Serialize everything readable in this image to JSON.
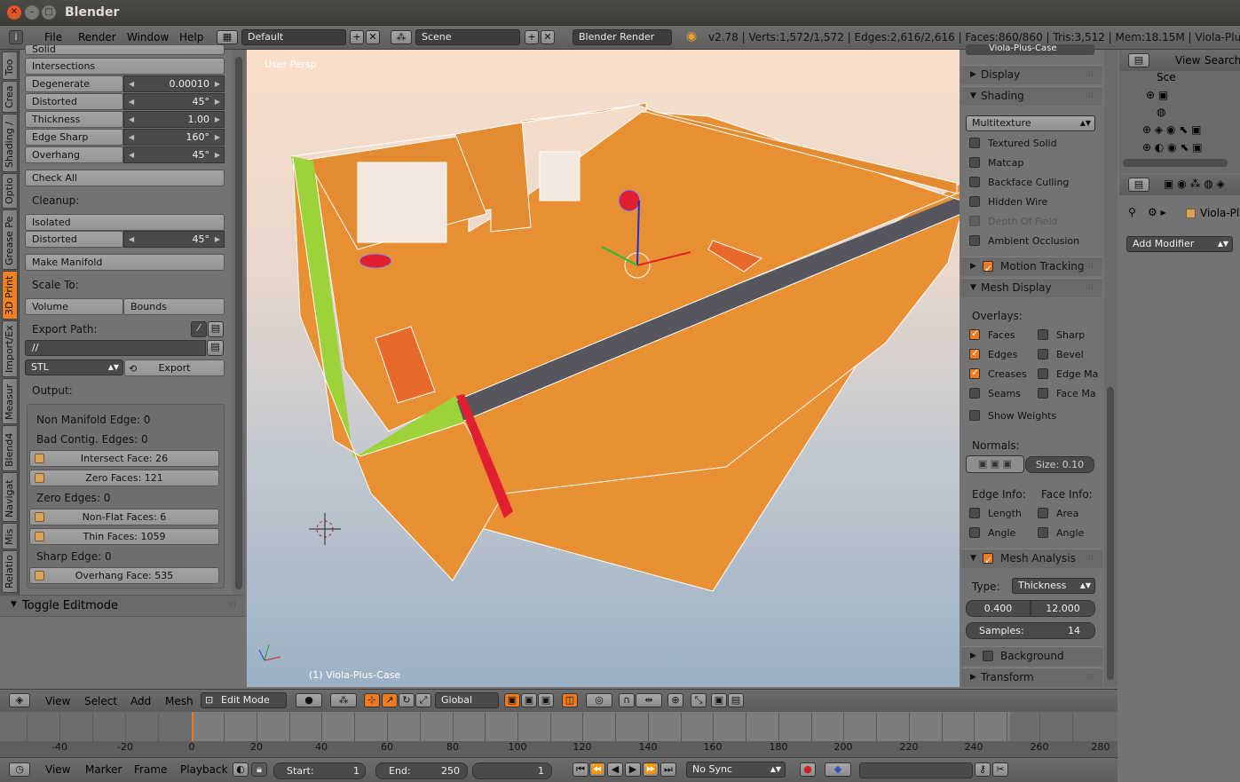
{
  "window": {
    "title": "Blender"
  },
  "info_header": {
    "menus": [
      "File",
      "Render",
      "Window",
      "Help"
    ],
    "screen_layout": "Default",
    "scene": "Scene",
    "render_engine": "Blender Render",
    "stats": "v2.78 | Verts:1,572/1,572 | Edges:2,616/2,616 | Faces:860/860 | Tris:3,512 | Mem:18.15M | Viola-Plus..."
  },
  "tabs": [
    "Too",
    "Crea",
    "Shading /",
    "Optio",
    "Grease Pe",
    "3D Print",
    "Import/Ex",
    "Measur",
    "Blend4",
    "Navigat",
    "Mis",
    "Relatio"
  ],
  "toolshelf": {
    "rows": [
      {
        "label": "Solid"
      },
      {
        "label": "Intersections"
      },
      {
        "label": "Degenerate",
        "value": "0.00010"
      },
      {
        "label": "Distorted",
        "value": "45°"
      },
      {
        "label": "Thickness",
        "value": "1.00"
      },
      {
        "label": "Edge Sharp",
        "value": "160°"
      },
      {
        "label": "Overhang",
        "value": "45°"
      }
    ],
    "check_all": "Check All",
    "cleanup_label": "Cleanup:",
    "isolated": "Isolated",
    "distorted2_label": "Distorted",
    "distorted2_value": "45°",
    "make_manifold": "Make Manifold",
    "scale_to_label": "Scale To:",
    "volume": "Volume",
    "bounds": "Bounds",
    "export_path_label": "Export Path:",
    "export_path_value": "//",
    "format": "STL",
    "export_button": "Export",
    "output_label": "Output:",
    "output": {
      "non_manifold": "Non Manifold Edge: 0",
      "bad_contig": "Bad Contig. Edges: 0",
      "intersect": "Intersect Face: 26",
      "zero_faces": "Zero Faces: 121",
      "zero_edges": "Zero Edges: 0",
      "non_flat": "Non-Flat Faces: 6",
      "thin": "Thin Faces: 1059",
      "sharp": "Sharp Edge: 0",
      "overhang": "Overhang Face: 535"
    },
    "toggle_editmode": "Toggle Editmode"
  },
  "viewport": {
    "label": "User Persp",
    "object_label": "(1) Viola-Plus-Case"
  },
  "properties": {
    "object_name": "Viola-Plus-Case",
    "display": "Display",
    "shading": "Shading",
    "shading_mode": "Multitexture",
    "shading_options": [
      "Textured Solid",
      "Matcap",
      "Backface Culling",
      "Hidden Wire",
      "Depth Of Field",
      "Ambient Occlusion"
    ],
    "motion_tracking": "Motion Tracking",
    "mesh_display": "Mesh Display",
    "overlays_label": "Overlays:",
    "overlays_left": [
      "Faces",
      "Edges",
      "Creases",
      "Seams"
    ],
    "overlays_right": [
      "Sharp",
      "Bevel",
      "Edge Ma",
      "Face Ma"
    ],
    "show_weights": "Show Weights",
    "normals_label": "Normals:",
    "normals_size": "Size:  0.10",
    "edge_info": "Edge Info:",
    "face_info": "Face Info:",
    "edge_length": "Length",
    "edge_angle": "Angle",
    "face_area": "Area",
    "face_angle": "Angle",
    "mesh_analysis": "Mesh Analysis",
    "type_label": "Type:",
    "type_value": "Thickness",
    "min": "0.400",
    "max": "12.000",
    "samples": "Samples:",
    "samples_value": "14",
    "background_images": "Background Images",
    "transform_orientations": "Transform Orientations"
  },
  "outliner": {
    "view": "View",
    "search": "Search",
    "scene_item": "Sce"
  },
  "prop_editor": {
    "object": "Viola-Pl",
    "add_modifier": "Add Modifier"
  },
  "view_header": {
    "menus": [
      "View",
      "Select",
      "Add",
      "Mesh"
    ],
    "mode": "Edit Mode",
    "orientation": "Global"
  },
  "timeline": {
    "ticks": [
      "-40",
      "-20",
      "0",
      "20",
      "40",
      "60",
      "80",
      "100",
      "120",
      "140",
      "160",
      "180",
      "200",
      "220",
      "240",
      "260",
      "280"
    ],
    "menus": [
      "View",
      "Marker",
      "Frame",
      "Playback"
    ],
    "start_label": "Start:",
    "start": "1",
    "end_label": "End:",
    "end": "250",
    "current": "1",
    "sync": "No Sync"
  },
  "colors": {
    "accent": "#f08020",
    "mesh": "#e99034",
    "panel": "#737373"
  }
}
